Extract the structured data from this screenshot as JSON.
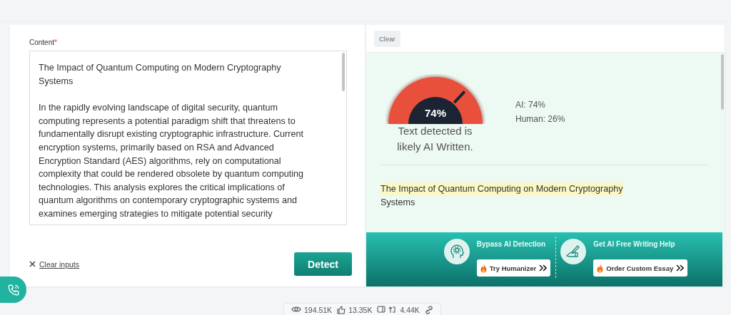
{
  "input_panel": {
    "label": "Content",
    "required_mark": "*",
    "text_title": "The Impact of Quantum Computing on Modern Cryptography Systems",
    "text_body": "In the rapidly evolving landscape of digital security, quantum computing represents a potential paradigm shift that threatens to fundamentally disrupt existing cryptographic infrastructure. Current encryption systems, primarily based on RSA and Advanced Encryption Standard (AES) algorithms, rely on computational complexity that could be rendered obsolete by quantum computing technologies. This analysis explores the critical implications of quantum algorithms on contemporary cryptographic systems and examines emerging strategies to mitigate potential security",
    "clear_link": "Clear inputs",
    "detect_button": "Detect"
  },
  "result_panel": {
    "clear_button": "Clear",
    "gauge": {
      "level": 0.74,
      "reading": "74%"
    },
    "verdict": "Text detected is likely AI Written.",
    "ai_share": "AI: 74%",
    "human_share": "Human: 26%",
    "analyzed_text": [
      {
        "text": "The Impact of Quantum Computing on Modern Cryptography",
        "highlighted": true
      },
      {
        "text": "Systems",
        "highlighted": false
      }
    ]
  },
  "promos": [
    {
      "title": "Bypass AI Detection",
      "button": "Try Humanizer",
      "kind": "head"
    },
    {
      "title": "Get AI Free Writing Help",
      "button": "Order Custom Essay",
      "kind": "pen"
    }
  ],
  "stats": [
    "194.51K",
    "13.35K",
    "4.44K"
  ]
}
